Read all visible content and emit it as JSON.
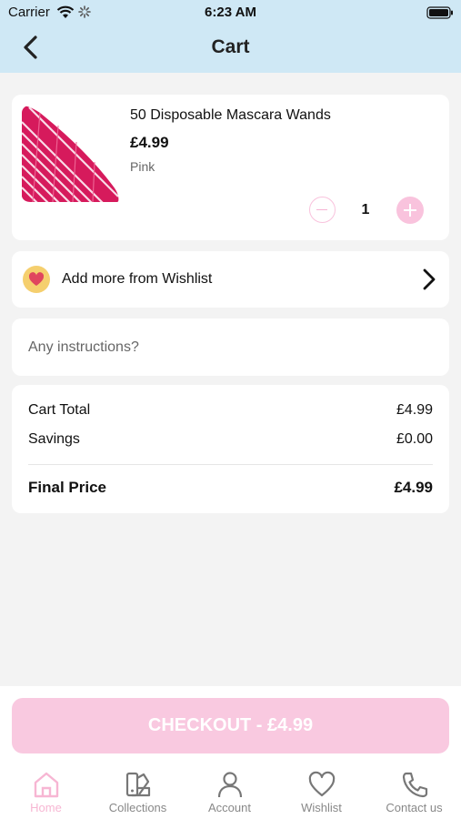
{
  "status_bar": {
    "carrier": "Carrier",
    "time": "6:23 AM"
  },
  "header": {
    "title": "Cart"
  },
  "cart_item": {
    "name": "50 Disposable Mascara Wands",
    "price": "£4.99",
    "variant": "Pink",
    "quantity": "1"
  },
  "wishlist": {
    "label": "Add more from Wishlist"
  },
  "instructions": {
    "placeholder": "Any instructions?"
  },
  "totals": {
    "cart_total_label": "Cart Total",
    "cart_total_value": "£4.99",
    "savings_label": "Savings",
    "savings_value": "£0.00",
    "final_label": "Final Price",
    "final_value": "£4.99"
  },
  "checkout": {
    "label": "CHECKOUT - £4.99"
  },
  "tabs": [
    {
      "label": "Home",
      "icon": "home-icon",
      "active": true
    },
    {
      "label": "Collections",
      "icon": "collections-icon",
      "active": false
    },
    {
      "label": "Account",
      "icon": "account-icon",
      "active": false
    },
    {
      "label": "Wishlist",
      "icon": "heart-icon",
      "active": false
    },
    {
      "label": "Contact us",
      "icon": "phone-icon",
      "active": false
    }
  ],
  "colors": {
    "header_bg": "#cfe8f5",
    "accent_pink": "#f9c3dd",
    "active_tab": "#f7b6d3",
    "wishlist_badge": "#f5cf6e"
  }
}
